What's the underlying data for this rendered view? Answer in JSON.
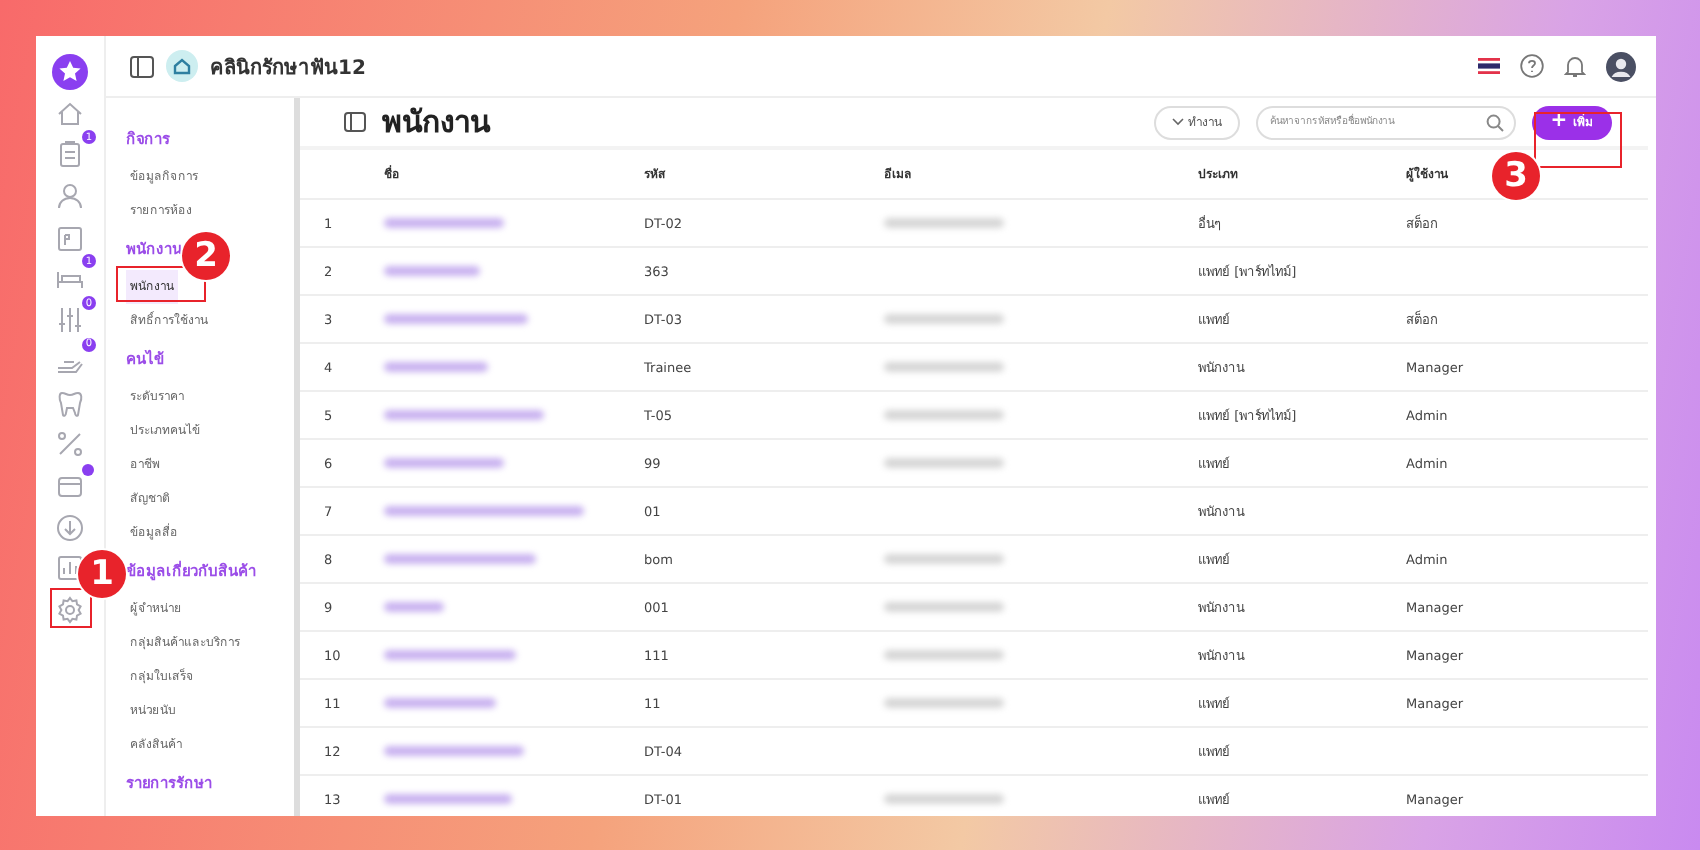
{
  "clinic": {
    "name": "คลินิกรักษาฟัน12"
  },
  "rail": [
    {
      "kind": "logo"
    },
    {
      "kind": "home"
    },
    {
      "kind": "clipboard",
      "badge": "1"
    },
    {
      "kind": "user"
    },
    {
      "kind": "calendar"
    },
    {
      "kind": "bed",
      "badge": "1"
    },
    {
      "kind": "sliders",
      "badge": "0"
    },
    {
      "kind": "hand",
      "badge": "0"
    },
    {
      "kind": "tooth"
    },
    {
      "kind": "percent"
    },
    {
      "kind": "box",
      "dot": true
    },
    {
      "kind": "download"
    },
    {
      "kind": "chart"
    },
    {
      "kind": "settings"
    }
  ],
  "sidebar": [
    {
      "heading": "กิจการ",
      "items": [
        {
          "label": "ข้อมูลกิจการ",
          "selected": false
        },
        {
          "label": "รายการห้อง",
          "selected": false
        }
      ]
    },
    {
      "heading": "พนักงาน",
      "items": [
        {
          "label": "พนักงาน",
          "selected": true
        },
        {
          "label": "สิทธิ์การใช้งาน",
          "selected": false
        }
      ]
    },
    {
      "heading": "คนไข้",
      "items": [
        {
          "label": "ระดับราคา",
          "selected": false
        },
        {
          "label": "ประเภทคนไข้",
          "selected": false
        },
        {
          "label": "อาชีพ",
          "selected": false
        },
        {
          "label": "สัญชาติ",
          "selected": false
        },
        {
          "label": "ข้อมูลสื่อ",
          "selected": false
        }
      ]
    },
    {
      "heading": "ข้อมูลเกี่ยวกับสินค้า",
      "items": [
        {
          "label": "ผู้จำหน่าย",
          "selected": false
        },
        {
          "label": "กลุ่มสินค้าและบริการ",
          "selected": false
        },
        {
          "label": "กลุ่มใบเสร็จ",
          "selected": false
        },
        {
          "label": "หน่วยนับ",
          "selected": false
        },
        {
          "label": "คลังสินค้า",
          "selected": false
        }
      ]
    },
    {
      "heading": "รายการรักษา"
    }
  ],
  "page": {
    "title": "พนักงาน",
    "filter": "ทำงาน",
    "search": {
      "placeholder": "ค้นหาจากรหัสหรือชื่อพนักงาน"
    },
    "add_button": {
      "icon": "+",
      "label": "เพิ่ม"
    }
  },
  "table": {
    "columns": [
      "ชื่อ",
      "รหัส",
      "อีเมล",
      "ประเภท",
      "ผู้ใช้งาน"
    ],
    "rows": [
      {
        "no": "1",
        "code": "DT-02",
        "email_shown": true,
        "type": "อื่นๆ",
        "user": "สต็อก"
      },
      {
        "no": "2",
        "code": "363",
        "email_shown": false,
        "type": "แพทย์ [พาร์ทไทม์]"
      },
      {
        "no": "3",
        "code": "DT-03",
        "email_shown": true,
        "type": "แพทย์",
        "user": "สต็อก"
      },
      {
        "no": "4",
        "code": "Trainee",
        "email_shown": true,
        "type": "พนักงาน",
        "user": "Manager"
      },
      {
        "no": "5",
        "code": "T-05",
        "email_shown": true,
        "type": "แพทย์ [พาร์ทไทม์]",
        "user": "Admin"
      },
      {
        "no": "6",
        "code": "99",
        "email_shown": true,
        "type": "แพทย์",
        "user": "Admin"
      },
      {
        "no": "7",
        "code": "01",
        "email_shown": false,
        "type": "พนักงาน"
      },
      {
        "no": "8",
        "code": "bom",
        "email_shown": true,
        "type": "แพทย์",
        "user": "Admin"
      },
      {
        "no": "9",
        "code": "001",
        "email_shown": true,
        "type": "พนักงาน",
        "user": "Manager"
      },
      {
        "no": "10",
        "code": "111",
        "email_shown": true,
        "type": "พนักงาน",
        "user": "Manager"
      },
      {
        "no": "11",
        "code": "11",
        "email_shown": true,
        "type": "แพทย์",
        "user": "Manager"
      },
      {
        "no": "12",
        "code": "DT-04",
        "email_shown": false,
        "type": "แพทย์"
      },
      {
        "no": "13",
        "code": "DT-01",
        "email_shown": true,
        "type": "แพทย์",
        "user": "Manager"
      }
    ]
  },
  "annotations": [
    {
      "label": "1"
    },
    {
      "label": "2"
    },
    {
      "label": "3"
    }
  ]
}
